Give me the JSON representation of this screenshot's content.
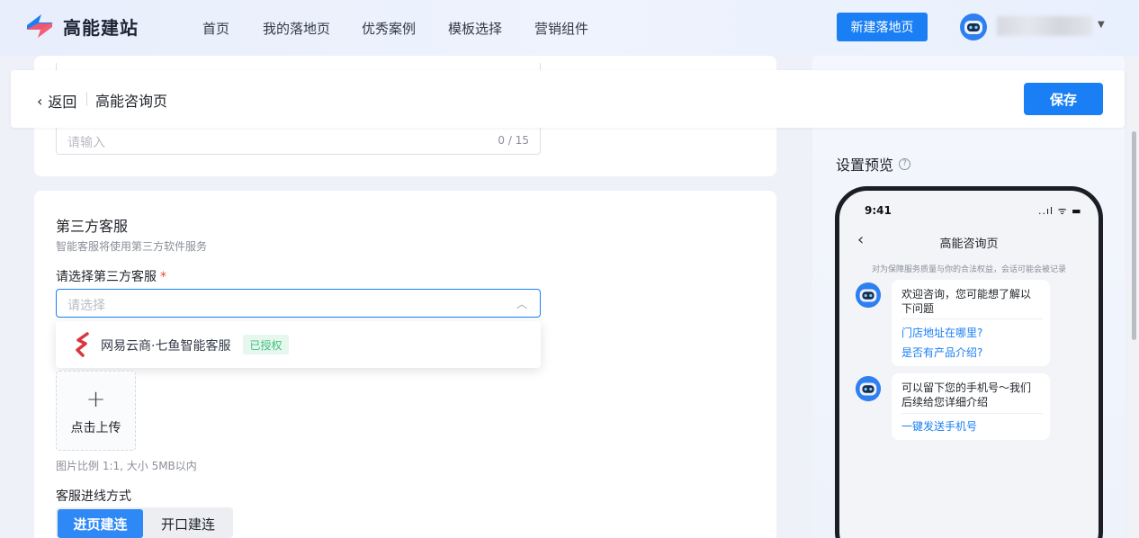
{
  "app": {
    "name": "高能建站",
    "brand_color": "#1a7ff5"
  },
  "nav": {
    "items": [
      "首页",
      "我的落地页",
      "优秀案例",
      "模板选择",
      "营销组件"
    ],
    "new_button": "新建落地页"
  },
  "subbar": {
    "back_label": "返回",
    "page_title": "高能咨询页",
    "save_label": "保存"
  },
  "form": {
    "name_input": {
      "placeholder": "请输入",
      "counter": "0 / 15"
    },
    "third_party": {
      "title": "第三方客服",
      "description": "智能客服将使用第三方软件服务",
      "select_label": "请选择第三方客服",
      "required_mark": "*",
      "select_placeholder": "请选择",
      "option": {
        "label": "网易云商·七鱼智能客服",
        "tag": "已授权"
      }
    },
    "upload": {
      "plus": "+",
      "label": "点击上传",
      "hint": "图片比例 1:1, 大小 5MB以内"
    },
    "connect": {
      "label": "客服进线方式",
      "options": [
        "进页建连",
        "开口建连"
      ],
      "selected": "进页建连"
    }
  },
  "preview": {
    "title": "设置预览",
    "help": "?",
    "phone": {
      "time": "9:41",
      "status": "..ıl ᯤ ▬",
      "back": "‹",
      "title": "高能咨询页",
      "notice": "对为保障服务质量与你的合法权益，会话可能会被记录",
      "bubble1": {
        "text": "欢迎咨询，您可能想了解以下问题",
        "links": [
          "门店地址在哪里?",
          "是否有产品介绍?"
        ]
      },
      "bubble2": {
        "text": "可以留下您的手机号～我们后续给您详细介绍",
        "link": "一键发送手机号"
      }
    }
  }
}
